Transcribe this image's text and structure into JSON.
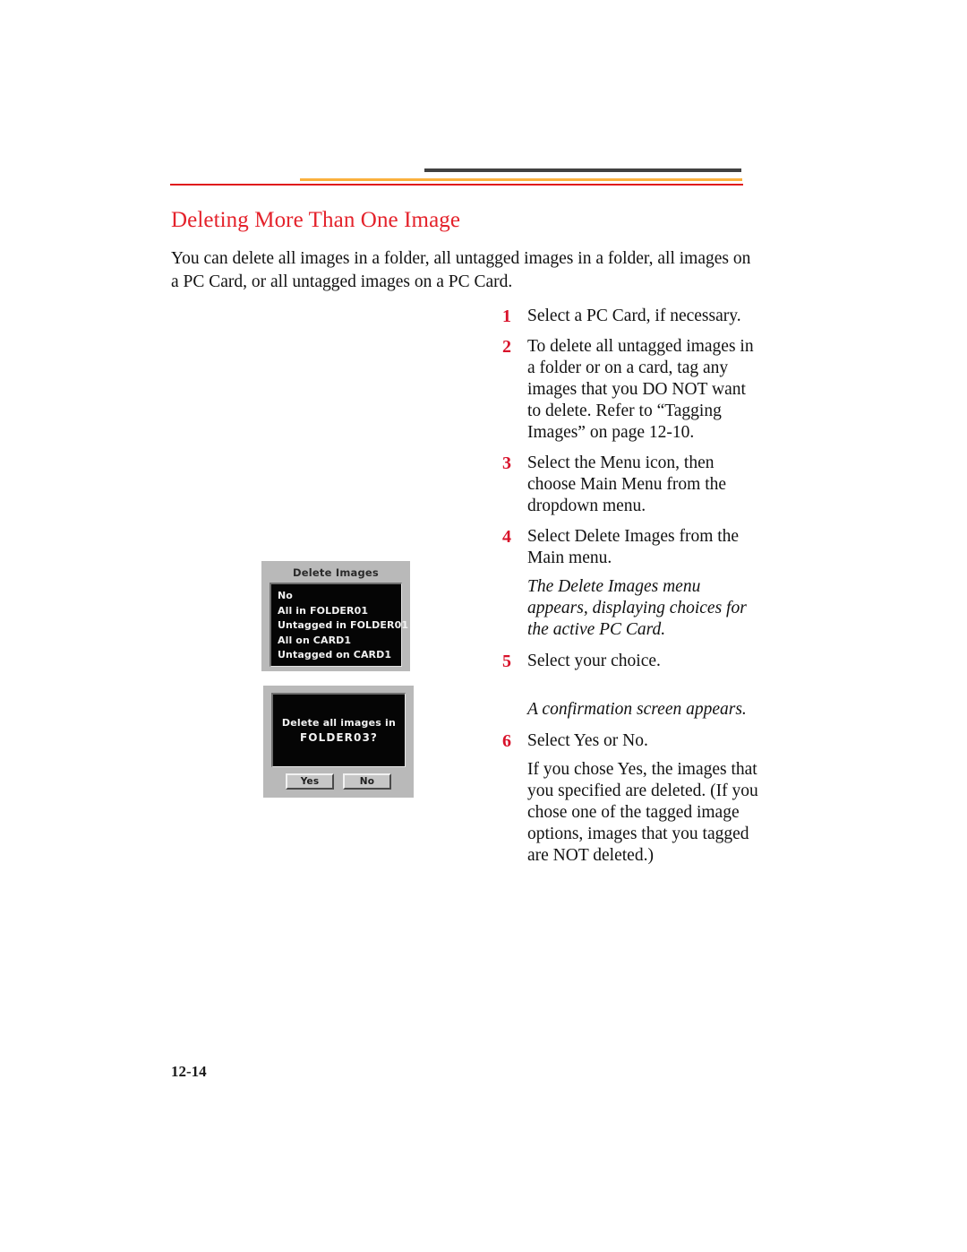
{
  "document": {
    "heading": "Deleting More Than One Image",
    "intro": "You can delete all images in a folder, all untagged images in a folder, all images on a PC Card, or all untagged images on a PC Card.",
    "page_number": "12-14"
  },
  "rules": {
    "gray_color": "#414141",
    "orange_color": "#fbb03b",
    "red_color": "#e0191c"
  },
  "steps": [
    {
      "number": "1",
      "text": "Select a PC Card, if necessary."
    },
    {
      "number": "2",
      "text": "To delete all untagged images in a folder or on a card, tag any images that you DO NOT want to delete. Refer to “Tagging Images” on page 12-10."
    },
    {
      "number": "3",
      "text": "Select the Menu icon, then choose Main Menu from the dropdown menu."
    },
    {
      "number": "4",
      "text": "Select Delete Images from the Main menu.",
      "note": "The Delete Images menu appears, displaying choices for the active PC Card."
    },
    {
      "number": "5",
      "text": "Select your choice.",
      "note": "A confirmation screen appears."
    },
    {
      "number": "6",
      "text": "Select Yes or No.",
      "follow": "If you chose Yes, the images that you specified are deleted. (If you chose one of the tagged image options, images that you tagged are NOT deleted.)"
    }
  ],
  "figures": {
    "delete_images_menu": {
      "title": "Delete Images",
      "items": [
        "No",
        "All in FOLDER01",
        "Untagged in FOLDER01",
        "All on CARD1",
        "Untagged on CARD1"
      ]
    },
    "confirmation_screen": {
      "line1": "Delete all images in",
      "line2": "FOLDER03?",
      "yes_label": "Yes",
      "no_label": "No"
    }
  }
}
